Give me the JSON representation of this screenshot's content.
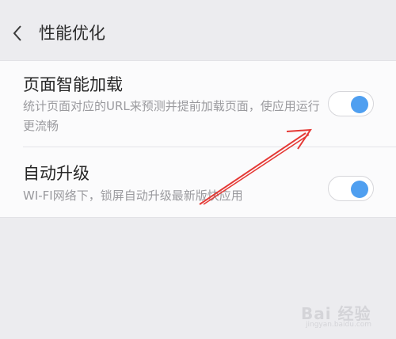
{
  "header": {
    "title": "性能优化",
    "back_icon": "chevron-left-icon"
  },
  "settings": [
    {
      "title": "页面智能加载",
      "description": "统计页面对应的URL来预测并提前加载页面，使应用运行更流畅",
      "enabled": true
    },
    {
      "title": "自动升级",
      "description": "WI-FI网络下，锁屏自动升级最新版快应用",
      "enabled": true
    }
  ],
  "annotation": {
    "color": "#e53935"
  },
  "watermark": {
    "logo": "Bai 经验",
    "url": "jingyan.baidu.com"
  },
  "colors": {
    "accent": "#4f9ff0",
    "background": "#ececef"
  }
}
